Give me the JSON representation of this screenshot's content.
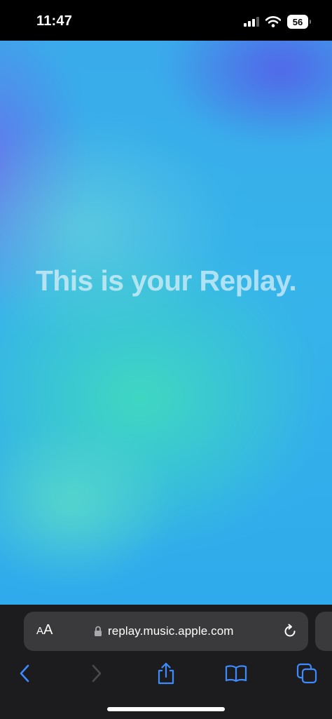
{
  "status_bar": {
    "time": "11:47",
    "battery_level": "56",
    "icons": [
      "cellular-signal-icon",
      "wifi-icon",
      "battery-icon"
    ]
  },
  "page": {
    "headline": "This is your Replay.",
    "colors": {
      "blue": "#36b4ea",
      "teal": "#40dabe",
      "purple": "#6870ec"
    }
  },
  "toolbar": {
    "text_size_small": "A",
    "text_size_large": "A",
    "url": "replay.music.apple.com",
    "icons": [
      "lock-icon",
      "reload-icon",
      "back-icon",
      "forward-icon",
      "share-icon",
      "bookmarks-icon",
      "tabs-icon"
    ],
    "accent_color": "#3d8bfd",
    "disabled_color": "#4a4a4e"
  }
}
